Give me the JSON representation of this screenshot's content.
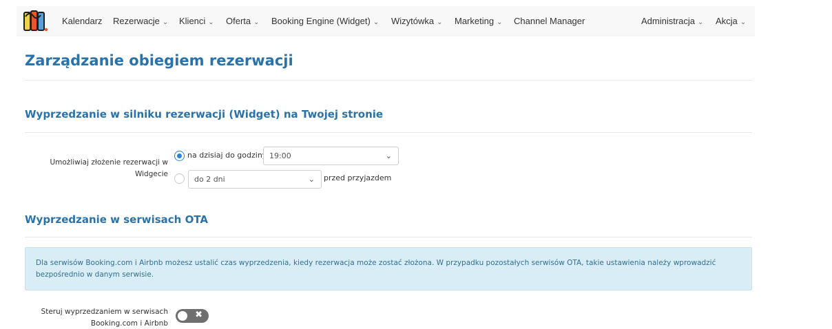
{
  "nav": {
    "logo_icon": "hotel-logo-icon",
    "items": [
      {
        "label": "Kalendarz",
        "dropdown": false
      },
      {
        "label": "Rezerwacje",
        "dropdown": true
      },
      {
        "label": "Klienci",
        "dropdown": true
      },
      {
        "label": "Oferta",
        "dropdown": true
      },
      {
        "label": "Booking Engine (Widget)",
        "dropdown": true
      },
      {
        "label": "Wizytówka",
        "dropdown": true
      },
      {
        "label": "Marketing",
        "dropdown": true
      },
      {
        "label": "Channel Manager",
        "dropdown": false
      },
      {
        "label": "Administracja",
        "dropdown": true
      },
      {
        "label": "Akcja",
        "dropdown": true
      }
    ],
    "chevron": "⌄"
  },
  "page": {
    "title": "Zarządzanie obiegiem rezerwacji"
  },
  "widget_section": {
    "title": "Wyprzedzanie w silniku rezerwacji (Widget) na Twojej stronie",
    "label_line1": "Umożliwiaj złożenie rezerwacji w",
    "label_line2": "Widgecie",
    "option1": {
      "selected": true,
      "text": "na dzisiaj do godziny",
      "select_value": "19:00"
    },
    "option2": {
      "selected": false,
      "select_value": "do 2 dni",
      "suffix": "przed przyjazdem"
    }
  },
  "ota_section": {
    "title": "Wyprzedzanie w serwisach OTA",
    "info_text": "Dla serwisów Booking.com i Airbnb możesz ustalić czas wyprzedzenia, kiedy rezerwacja może zostać złożona. W przypadku pozostałych serwisów OTA, takie ustawienia należy wprowadzić bezpośrednio w danym serwisie.",
    "toggle_label_line1": "Steruj wyprzedzaniem w serwisach",
    "toggle_label_line2": "Booking.com i Airbnb",
    "toggle_on": false,
    "toggle_glyph": "✖"
  },
  "colors": {
    "accent": "#2a72a8",
    "radio": "#2a82d8",
    "info_bg": "#d9edf7",
    "info_text": "#31708f",
    "toggle_off": "#6f6f6f"
  }
}
